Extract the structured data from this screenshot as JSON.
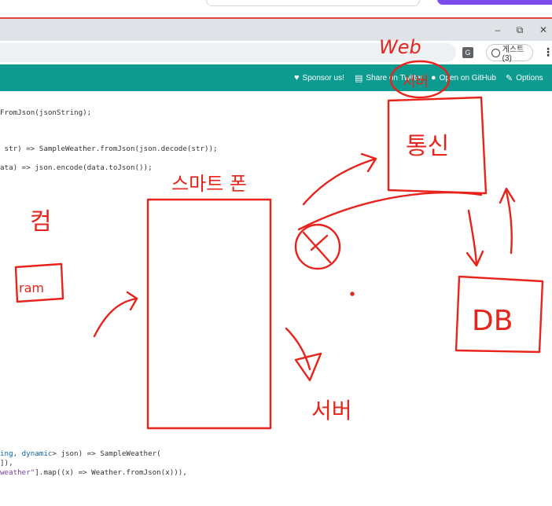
{
  "nav": {
    "sponsor": "Sponsor us!",
    "share": "Share on Twitter",
    "github": "Open on GitHub",
    "options": "Options"
  },
  "browser": {
    "guest_label": "게스트(3)",
    "window_min": "–",
    "window_max": "⧉",
    "window_close": "✕",
    "translate_label": "G"
  },
  "code": {
    "line1": "FromJson(jsonString);",
    "line2": " str) => SampleWeather.fromJson(json.decode(str));",
    "line3": "ata) => json.encode(data.toJson());",
    "line4_kw": "ing, dynamic",
    "line4_rest": "> json) => SampleWeather(",
    "line5": "]),",
    "line6_str": "weather\"",
    "line6_rest": "].map((x) => Weather.fromJson(x))),"
  },
  "annotations": {
    "color": "#e8231b",
    "web_label": "Web",
    "web_sub": "서버",
    "cloud_label": "통신",
    "phone_label": "스마트 폰",
    "db_label": "DB",
    "server_label": "서버",
    "pc_label": "컴",
    "ram_label": "ram"
  }
}
